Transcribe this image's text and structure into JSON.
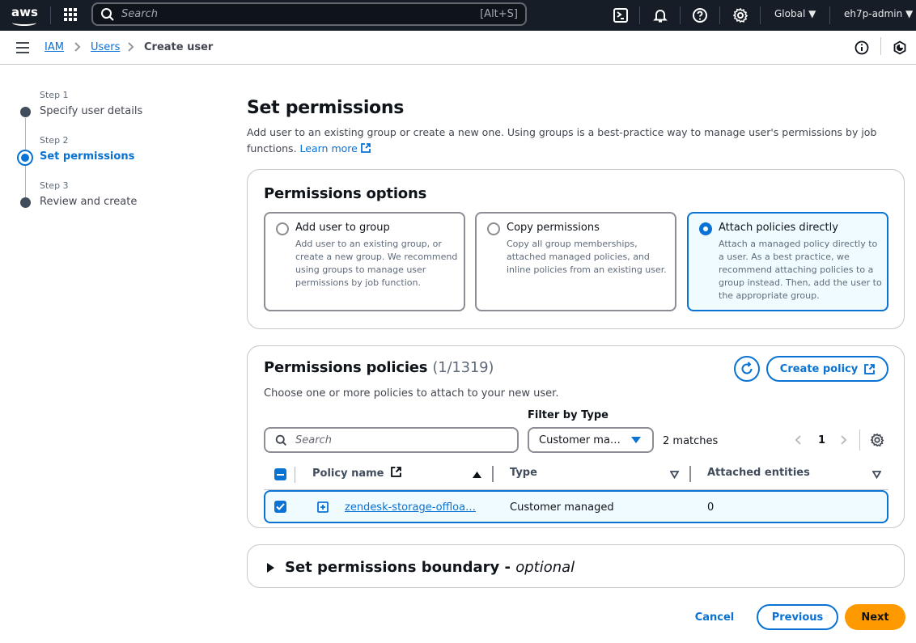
{
  "topbar": {
    "logo": "aws",
    "search_placeholder": "Search",
    "search_shortcut": "[Alt+S]",
    "region": "Global",
    "account": "eh7p-admin"
  },
  "breadcrumb": [
    {
      "label": "IAM"
    },
    {
      "label": "Users"
    },
    {
      "label": "Create user"
    }
  ],
  "steps": [
    {
      "label": "Step 1",
      "title": "Specify user details",
      "active": false
    },
    {
      "label": "Step 2",
      "title": "Set permissions",
      "active": true
    },
    {
      "label": "Step 3",
      "title": "Review and create",
      "active": false
    }
  ],
  "page": {
    "title": "Set permissions",
    "description": "Add user to an existing group or create a new one. Using groups is a best-practice way to manage user's permissions by job functions.",
    "learn_more": "Learn more"
  },
  "permissions_options": {
    "heading": "Permissions options",
    "options": [
      {
        "title": "Add user to group",
        "desc": "Add user to an existing group, or create a new group. We recommend using groups to manage user permissions by job function.",
        "selected": false
      },
      {
        "title": "Copy permissions",
        "desc": "Copy all group memberships, attached managed policies, and inline policies from an existing user.",
        "selected": false
      },
      {
        "title": "Attach policies directly",
        "desc": "Attach a managed policy directly to a user. As a best practice, we recommend attaching policies to a group instead. Then, add the user to the appropriate group.",
        "selected": true
      }
    ]
  },
  "policies": {
    "heading": "Permissions policies",
    "count": "(1/1319)",
    "subtitle": "Choose one or more policies to attach to your new user.",
    "create_policy": "Create policy",
    "search_placeholder": "Search",
    "filter_label": "Filter by Type",
    "filter_value": "Customer ma…",
    "matches": "2 matches",
    "page": "1",
    "columns": [
      "Policy name",
      "Type",
      "Attached entities"
    ],
    "rows": [
      {
        "name": "zendesk-storage-offloa…",
        "type": "Customer managed",
        "attached": "0",
        "checked": true
      }
    ]
  },
  "boundary": {
    "title": "Set permissions boundary - ",
    "optional": "optional"
  },
  "footer": {
    "cancel": "Cancel",
    "previous": "Previous",
    "next": "Next"
  },
  "colors": {
    "accent": "#0972d3",
    "primary_button": "#ff9900",
    "topbar": "#161d26"
  }
}
